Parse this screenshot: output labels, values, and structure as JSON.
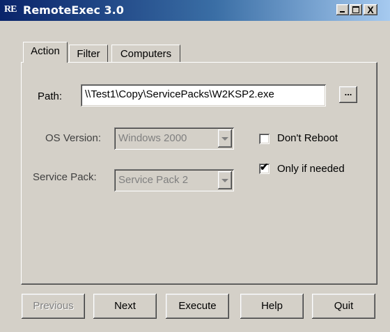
{
  "window": {
    "logo": "RE",
    "title": "RemoteExec 3.0",
    "minimize_icon": "minimize-icon",
    "maximize_icon": "maximize-icon",
    "close_glyph": "X"
  },
  "tabs": [
    {
      "label": "Action",
      "active": true
    },
    {
      "label": "Filter",
      "active": false
    },
    {
      "label": "Computers",
      "active": false
    }
  ],
  "action": {
    "path_label": "Path:",
    "path_value": "\\\\Test1\\Copy\\ServicePacks\\W2KSP2.exe",
    "browse_label": "...",
    "os_label": "OS Version:",
    "os_value": "Windows 2000",
    "os_enabled": false,
    "sp_label": "Service Pack:",
    "sp_value": "Service Pack 2",
    "sp_enabled": false,
    "dont_reboot": {
      "label": "Don't Reboot",
      "checked": false
    },
    "only_if_needed": {
      "label": "Only if needed",
      "checked": true,
      "mark": "✔"
    }
  },
  "buttons": {
    "previous": "Previous",
    "next": "Next",
    "execute": "Execute",
    "help": "Help",
    "quit": "Quit"
  },
  "colors": {
    "titlebar_start": "#0a246a",
    "titlebar_end": "#a6caf0",
    "face": "#d4d0c8",
    "disabled_text": "#808080"
  }
}
